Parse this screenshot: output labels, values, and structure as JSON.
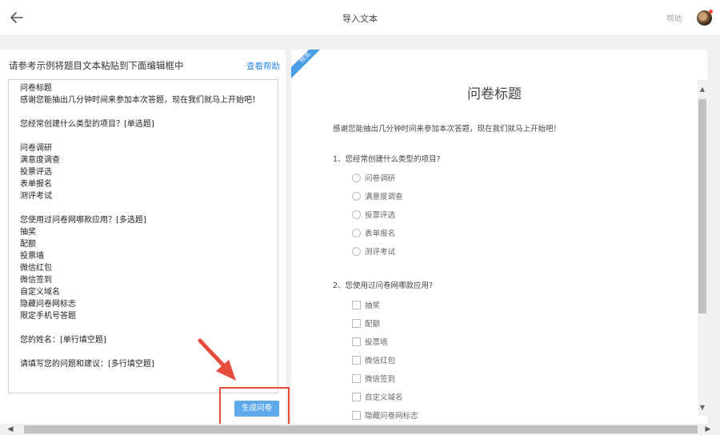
{
  "topbar": {
    "title": "导入文本",
    "help": "帮助"
  },
  "left": {
    "instruction": "请参考示例将题目文本粘贴到下面编辑框中",
    "view_help": "查看帮助",
    "editor_text": "问卷标题\n感谢您能抽出几分钟时间来参加本次答题，现在我们就马上开始吧！\n\n您经常创建什么类型的项目？[单选题]\n\n问卷调研\n满意度调查\n投票评选\n表单报名\n测评考试\n\n您使用过问卷网哪款应用？[多选题]\n抽奖\n配额\n投票墙\n微信红包\n微信签到\n自定义域名\n隐藏问卷网标志\n限定手机号答题\n\n您的姓名：[单行填空题]\n\n请填写您的问题和建议：[多行填空题]",
    "generate_button": "生成问卷"
  },
  "preview": {
    "ribbon": "预览",
    "title": "问卷标题",
    "description": "感谢您能抽出几分钟时间来参加本次答题，现在我们就马上开始吧！",
    "q1": {
      "title": "1、您经常创建什么类型的项目?",
      "options": [
        "问卷调研",
        "满意度调查",
        "投票评选",
        "表单报名",
        "测评考试"
      ]
    },
    "q2": {
      "title": "2、您使用过问卷网哪款应用?",
      "options": [
        "抽奖",
        "配额",
        "投票墙",
        "微信红包",
        "微信签到",
        "自定义域名",
        "隐藏问卷网标志"
      ]
    }
  },
  "colors": {
    "accent": "#2b85e4",
    "button": "#5ea8ec",
    "highlight": "#e84c3d",
    "ribbon": "#4a9de6"
  }
}
